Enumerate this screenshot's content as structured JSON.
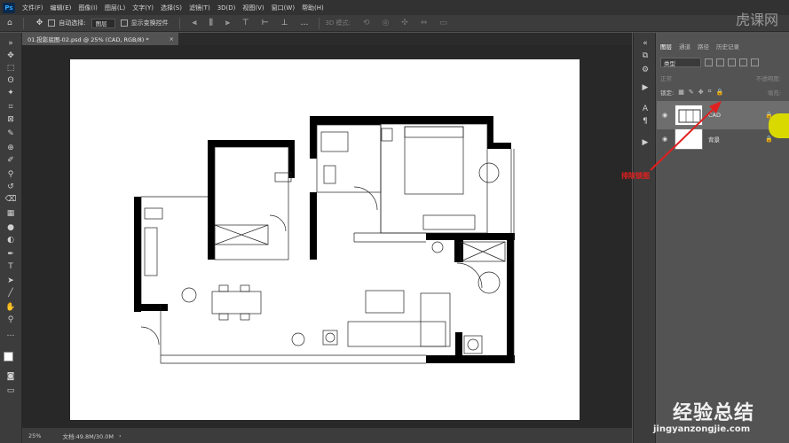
{
  "menubar": {
    "logo": "Ps",
    "items": [
      "文件(F)",
      "编辑(E)",
      "图像(I)",
      "图层(L)",
      "文字(Y)",
      "选择(S)",
      "滤镜(T)",
      "3D(D)",
      "视图(V)",
      "窗口(W)",
      "帮助(H)"
    ]
  },
  "optbar": {
    "auto_select_label": "自动选择:",
    "auto_select_value": "图层",
    "show_transform_label": "显示变换控件",
    "mode_3d_label": "3D 模式:"
  },
  "watermark_top": "虎课网",
  "document_tab": {
    "title": "01.投影底图-02.psd @ 25% (CAD, RGB/8) *",
    "close": "×"
  },
  "statusbar": {
    "zoom": "25%",
    "doc_info": "文档:49.8M/30.0M"
  },
  "panel": {
    "tabs": [
      "图层",
      "通道",
      "路径",
      "历史记录"
    ],
    "active_tab": "图层",
    "filter_kind": "类型",
    "blend_mode": "正常",
    "opacity_label": "不透明度:",
    "lock_label": "锁定:",
    "fill_label": "填充:",
    "layers": [
      {
        "name": "CAD",
        "selected": true,
        "locked": true
      },
      {
        "name": "背景",
        "selected": false,
        "locked": true
      }
    ]
  },
  "annotation": "排除锁图",
  "watermark_bottom": {
    "cn": "经验总结",
    "url": "jingyanzongjie.com"
  },
  "colors": {
    "menubar_bg": "#323232",
    "panel_bg": "#535353",
    "canvas_bg": "#282828",
    "annotation_red": "#e02020",
    "selected_layer": "#6e6e6e"
  }
}
